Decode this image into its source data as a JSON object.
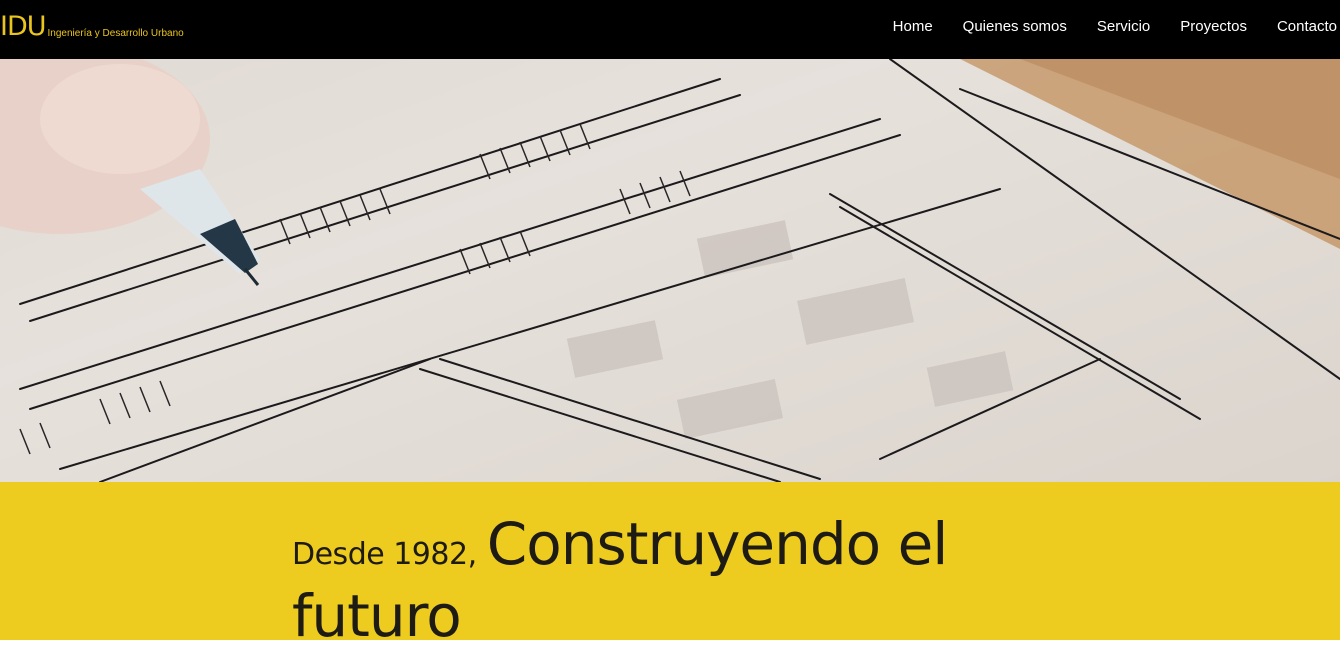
{
  "brand": {
    "name": "IDU",
    "subtitle": "Ingeniería y Desarrollo Urbano"
  },
  "nav": [
    {
      "label": "Home"
    },
    {
      "label": "Quienes somos"
    },
    {
      "label": "Servicio"
    },
    {
      "label": "Proyectos"
    },
    {
      "label": "Contacto"
    }
  ],
  "hero": {
    "image": "architectural-sketch-with-pen"
  },
  "band": {
    "lead": "Desde 1982,",
    "headline_line1": "Construyendo el",
    "headline_line2": "futuro"
  },
  "colors": {
    "navbar_bg": "#000000",
    "brand": "#e9c51e",
    "band_bg": "#edcb1f",
    "text_dark": "#1d1b14"
  }
}
